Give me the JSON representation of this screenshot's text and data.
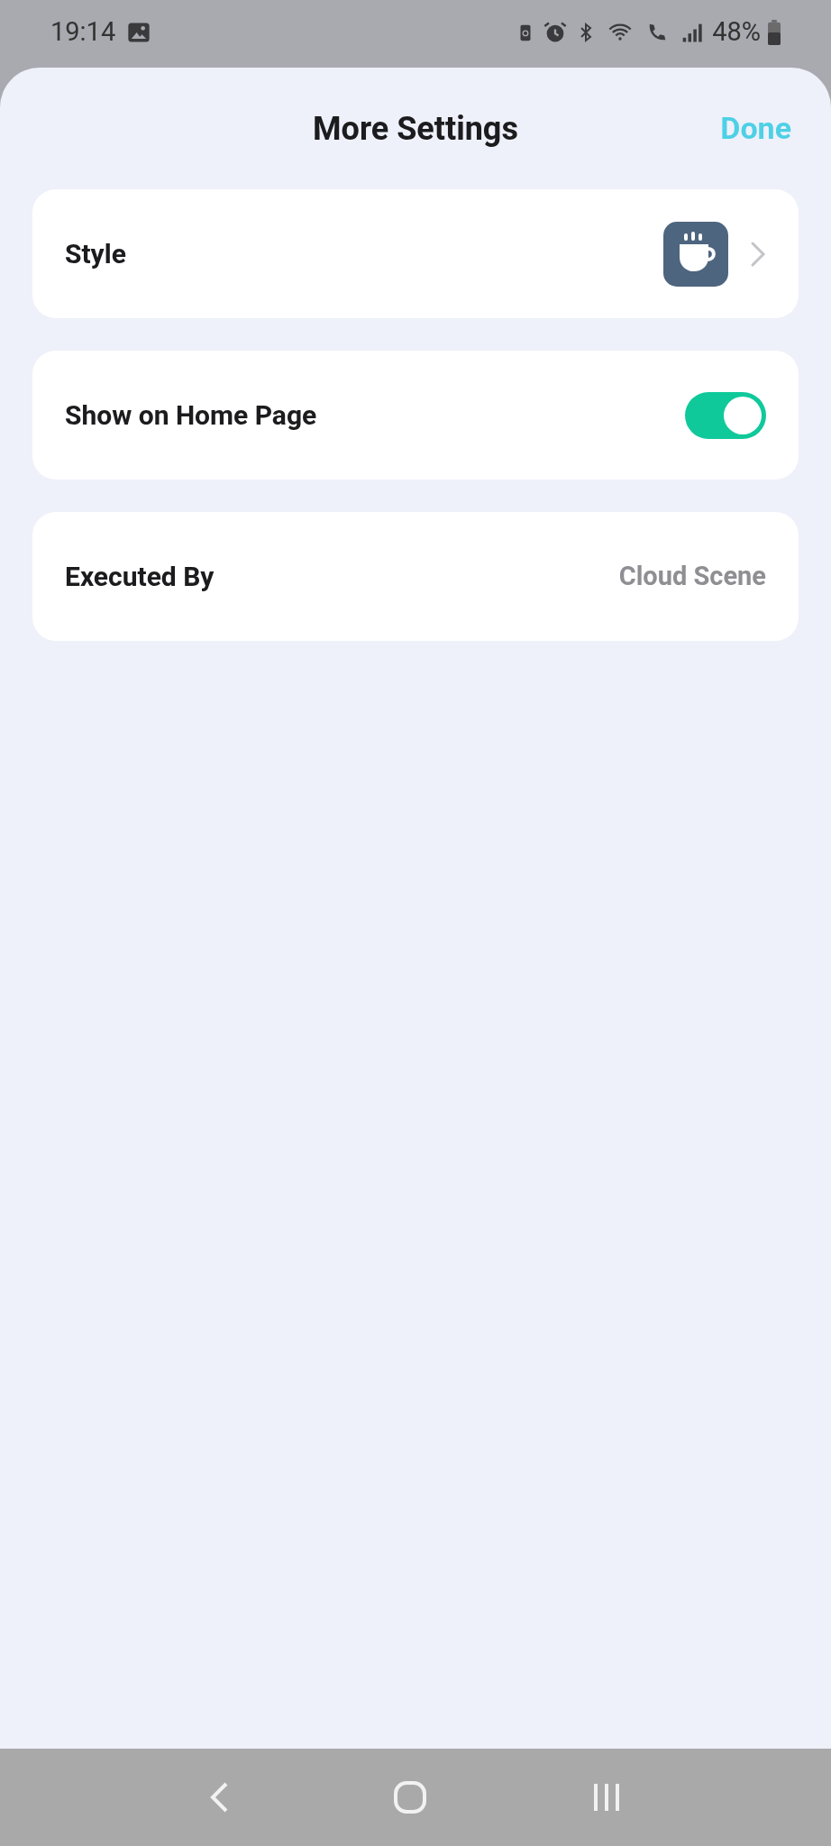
{
  "status_bar": {
    "time": "19:14",
    "battery": "48%"
  },
  "header": {
    "title": "More Settings",
    "done": "Done"
  },
  "rows": [
    {
      "kind": "style",
      "label": "Style"
    },
    {
      "kind": "toggle",
      "label": "Show on Home Page",
      "on": true
    },
    {
      "kind": "value",
      "label": "Executed By",
      "value": "Cloud Scene"
    }
  ]
}
